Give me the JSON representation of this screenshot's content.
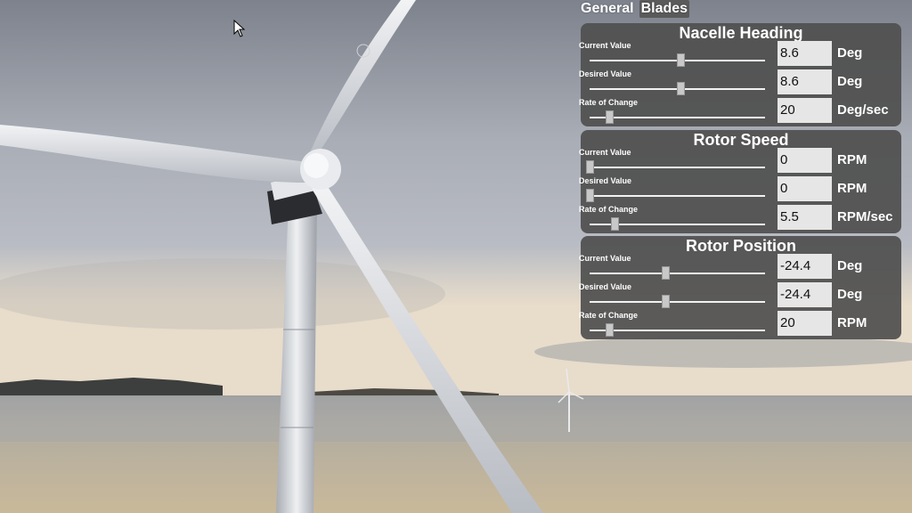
{
  "tabs": [
    {
      "label": "General",
      "active": false
    },
    {
      "label": "Blades",
      "active": true
    }
  ],
  "panels": [
    {
      "title": "Nacelle Heading",
      "rows": [
        {
          "label": "Current Value",
          "value": "8.6",
          "unit": "Deg",
          "slider_fraction": 0.52
        },
        {
          "label": "Desired Value",
          "value": "8.6",
          "unit": "Deg",
          "slider_fraction": 0.52
        },
        {
          "label": "Rate of Change",
          "value": "20",
          "unit": "Deg/sec",
          "slider_fraction": 0.11
        }
      ]
    },
    {
      "title": "Rotor Speed",
      "rows": [
        {
          "label": "Current Value",
          "value": "0",
          "unit": "RPM",
          "slider_fraction": 0.0
        },
        {
          "label": "Desired Value",
          "value": "0",
          "unit": "RPM",
          "slider_fraction": 0.0
        },
        {
          "label": "Rate of Change",
          "value": "5.5",
          "unit": "RPM/sec",
          "slider_fraction": 0.14
        }
      ]
    },
    {
      "title": "Rotor Position",
      "rows": [
        {
          "label": "Current Value",
          "value": "-24.4",
          "unit": "Deg",
          "slider_fraction": 0.43
        },
        {
          "label": "Desired Value",
          "value": "-24.4",
          "unit": "Deg",
          "slider_fraction": 0.43
        },
        {
          "label": "Rate of Change",
          "value": "20",
          "unit": "RPM",
          "slider_fraction": 0.11
        }
      ]
    }
  ],
  "colors": {
    "panel_bg": "#505050",
    "input_bg": "#e6e6e6",
    "text": "#ffffff"
  },
  "icons": {
    "cursor": "mouse-pointer-icon"
  }
}
